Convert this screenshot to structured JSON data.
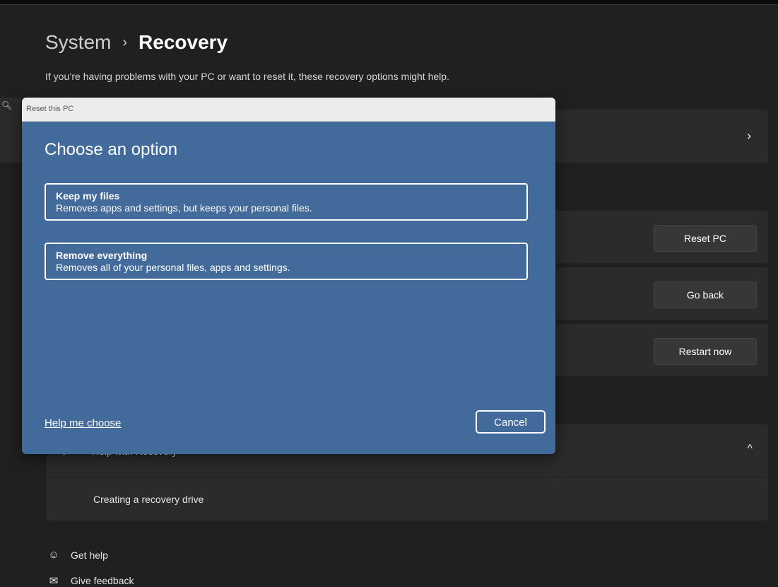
{
  "breadcrumb": {
    "parent": "System",
    "separator": "›",
    "current": "Recovery"
  },
  "subtitle": "If you’re having problems with your PC or want to reset it, these recovery options might help.",
  "recovery_options": {
    "fix_chevron": "›",
    "reset_button": "Reset PC",
    "go_back_button": "Go back",
    "restart_button": "Restart now"
  },
  "help_section": {
    "title": "Help with Recovery",
    "chevron": "^",
    "link": "Creating a recovery drive"
  },
  "footer": {
    "get_help": "Get help",
    "give_feedback": "Give feedback"
  },
  "dialog": {
    "window_title": "Reset this PC",
    "heading": "Choose an option",
    "options": [
      {
        "title": "Keep my files",
        "description": "Removes apps and settings, but keeps your personal files."
      },
      {
        "title": "Remove everything",
        "description": "Removes all of your personal files, apps and settings."
      }
    ],
    "help_link": "Help me choose",
    "cancel": "Cancel"
  },
  "colors": {
    "background": "#202020",
    "card": "#2b2b2b",
    "dialog": "#426a9b"
  }
}
